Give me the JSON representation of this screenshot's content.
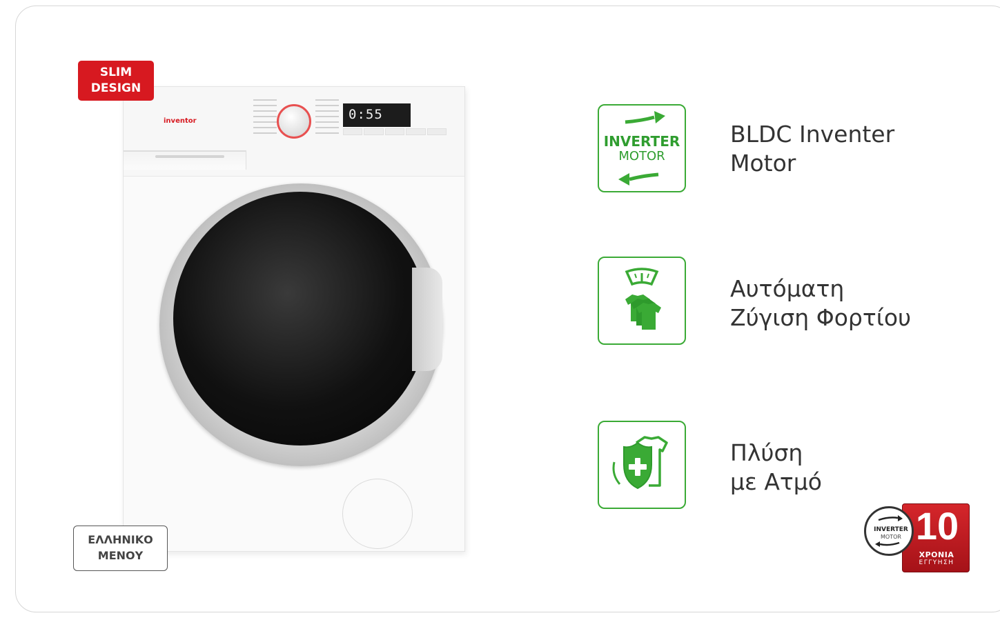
{
  "badges": {
    "slim_line1": "SLIM",
    "slim_line2": "DESIGN",
    "menu_line1": "ΕΛΛΗΝΙΚΟ",
    "menu_line2": "ΜΕΝΟΥ"
  },
  "machine": {
    "brand": "inventor",
    "display_time": "0:55"
  },
  "features": [
    {
      "icon": "inverter-motor-icon",
      "icon_line1": "INVERTER",
      "icon_line2": "MOTOR",
      "line1": "BLDC Inventer",
      "line2": "Motor"
    },
    {
      "icon": "scale-shirts-icon",
      "line1": "Αυτόματη",
      "line2": "Ζύγιση Φορτίου"
    },
    {
      "icon": "steam-shirt-shield-icon",
      "line1": "Πλύση",
      "line2": "με Ατμό"
    }
  ],
  "warranty": {
    "circle_line1": "INVERTER",
    "circle_line2": "MOTOR",
    "years": "10",
    "label_years": "ΧΡΟΝΙΑ",
    "label_guarantee": "ΕΓΓΥΗΣΗ"
  },
  "colors": {
    "accent_red": "#d71920",
    "feature_green": "#3aaa35"
  }
}
